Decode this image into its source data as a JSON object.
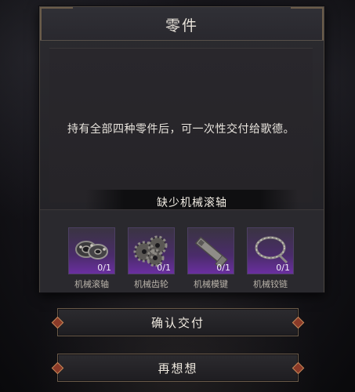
{
  "dialog": {
    "title": "零件",
    "description": "持有全部四种零件后，可一次性交付给歌德。",
    "status": "缺少机械滚轴"
  },
  "parts": [
    {
      "name": "机械滚轴",
      "count": "0/1",
      "icon": "roller-bearing-icon"
    },
    {
      "name": "机械齿轮",
      "count": "0/1",
      "icon": "gear-icon"
    },
    {
      "name": "机械模键",
      "count": "0/1",
      "icon": "key-icon"
    },
    {
      "name": "机械铰链",
      "count": "0/1",
      "icon": "chain-icon"
    }
  ],
  "buttons": {
    "confirm": "确认交付",
    "rethink": "再想想"
  },
  "colors": {
    "slot_purple": "#6a2fa0",
    "accent_bronze": "#6a5a48",
    "text": "#e8e3da"
  }
}
